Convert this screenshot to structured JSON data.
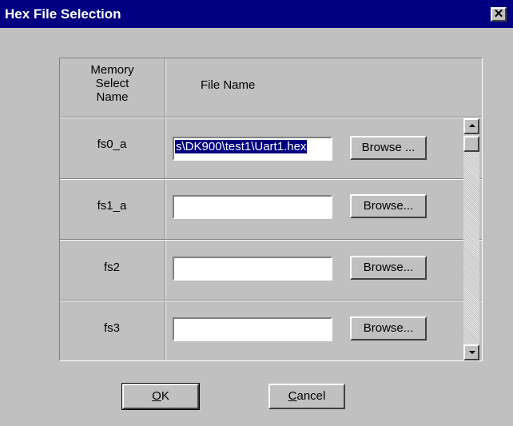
{
  "window": {
    "title": "Hex File Selection",
    "close_glyph": "✕"
  },
  "table": {
    "col_memory_select": "Memory\nSelect\nName",
    "col_file_name": "File Name",
    "rows": [
      {
        "name": "fs0_a",
        "file": "s\\DK900\\test1\\Uart1.hex",
        "browse": "Browse ..."
      },
      {
        "name": "fs1_a",
        "file": "",
        "browse": "Browse..."
      },
      {
        "name": "fs2",
        "file": "",
        "browse": "Browse..."
      },
      {
        "name": "fs3",
        "file": "",
        "browse": "Browse..."
      }
    ]
  },
  "buttons": {
    "ok_mnemonic": "O",
    "ok_rest": "K",
    "cancel_mnemonic": "C",
    "cancel_rest": "ancel"
  },
  "colors": {
    "titlebar": "#000080",
    "face": "#c0c0c0",
    "selection": "#000080"
  }
}
